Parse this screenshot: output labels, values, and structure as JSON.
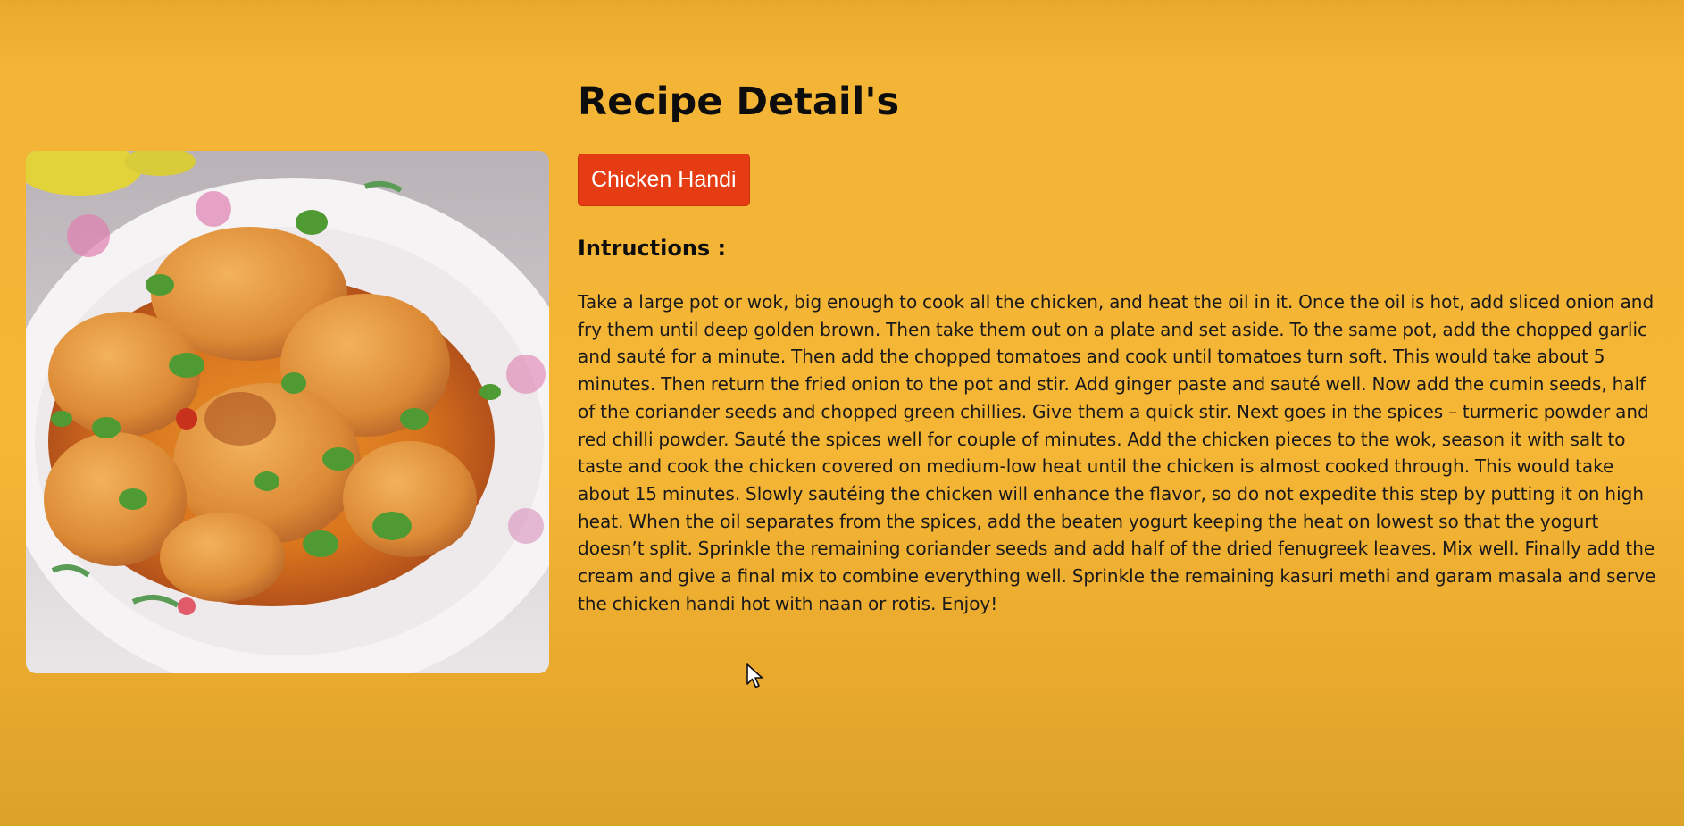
{
  "recipe": {
    "page_title": "Recipe Detail's",
    "name": "Chicken Handi",
    "instructions_label": "Intructions :",
    "instructions": "Take a large pot or wok, big enough to cook all the chicken, and heat the oil in it. Once the oil is hot, add sliced onion and fry them until deep golden brown. Then take them out on a plate and set aside. To the same pot, add the chopped garlic and sauté for a minute. Then add the chopped tomatoes and cook until tomatoes turn soft. This would take about 5 minutes. Then return the fried onion to the pot and stir. Add ginger paste and sauté well. Now add the cumin seeds, half of the coriander seeds and chopped green chillies. Give them a quick stir. Next goes in the spices – turmeric powder and red chilli powder. Sauté the spices well for couple of minutes. Add the chicken pieces to the wok, season it with salt to taste and cook the chicken covered on medium-low heat until the chicken is almost cooked through. This would take about 15 minutes. Slowly sautéing the chicken will enhance the flavor, so do not expedite this step by putting it on high heat. When the oil separates from the spices, add the beaten yogurt keeping the heat on lowest so that the yogurt doesn’t split. Sprinkle the remaining coriander seeds and add half of the dried fenugreek leaves. Mix well. Finally add the cream and give a final mix to combine everything well. Sprinkle the remaining kasuri methi and garam masala and serve the chicken handi hot with naan or rotis. Enjoy!"
  },
  "image": {
    "icon": "food-photo"
  },
  "colors": {
    "background": "#f5b535",
    "button": "#e53c13",
    "button_text": "#ffffff",
    "text": "#111111"
  },
  "cursor": {
    "icon": "mouse-pointer-icon"
  }
}
